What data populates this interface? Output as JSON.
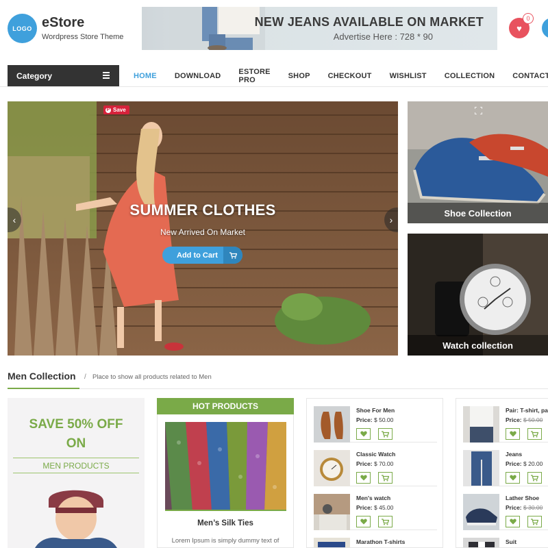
{
  "header": {
    "logo_text": "LOGO",
    "site_title": "eStore",
    "tagline": "Wordpress Store Theme",
    "ad_headline": "NEW JEANS AVAILABLE ON MARKET",
    "ad_sub": "Advertise Here : 728 * 90",
    "wishlist_count": "0"
  },
  "nav": {
    "category_label": "Category",
    "links": [
      "HOME",
      "DOWNLOAD",
      "ESTORE PRO",
      "SHOP",
      "CHECKOUT",
      "WISHLIST",
      "COLLECTION",
      "CONTACT"
    ],
    "active": "HOME"
  },
  "hero": {
    "pin_label": "Save",
    "title": "SUMMER CLOTHES",
    "subtitle": "New Arrived On Market",
    "cta_label": "Add to Cart"
  },
  "side_banners": [
    {
      "caption": "Shoe Collection"
    },
    {
      "caption": "Watch collection"
    }
  ],
  "section": {
    "title": "Men Collection",
    "separator": "/",
    "description": "Place to show all products related to Men"
  },
  "promo": {
    "line1": "SAVE 50% OFF",
    "line2": "ON",
    "line3": "MEN PRODUCTS"
  },
  "hot": {
    "heading": "HOT PRODUCTS",
    "name": "Men’s Silk Ties",
    "desc": "Lorem Ipsum is simply dummy text of"
  },
  "list_a": [
    {
      "name": "Shoe For Men",
      "price_label": "Price:",
      "price": "$ 50.00",
      "old_price": ""
    },
    {
      "name": "Classic Watch",
      "price_label": "Price:",
      "price": "$ 70.00",
      "old_price": ""
    },
    {
      "name": "Men's watch",
      "price_label": "Price:",
      "price": "$ 45.00",
      "old_price": ""
    },
    {
      "name": "Marathon T-shirts",
      "price_label": "",
      "price": "",
      "old_price": ""
    }
  ],
  "list_b": [
    {
      "name": "Pair: T-shirt, pa",
      "price_label": "Price:",
      "price": "",
      "old_price": "$ 50.00"
    },
    {
      "name": "Jeans",
      "price_label": "Price:",
      "price": "$ 20.00",
      "old_price": ""
    },
    {
      "name": "Lather Shoe",
      "price_label": "Price:",
      "price": "",
      "old_price": "$ 30.00"
    },
    {
      "name": "Suit",
      "price_label": "",
      "price": "",
      "old_price": ""
    }
  ],
  "colors": {
    "accent_blue": "#3fa0dc",
    "accent_green": "#7aaa48",
    "wishlist_red": "#e8525e",
    "dark": "#333333"
  }
}
